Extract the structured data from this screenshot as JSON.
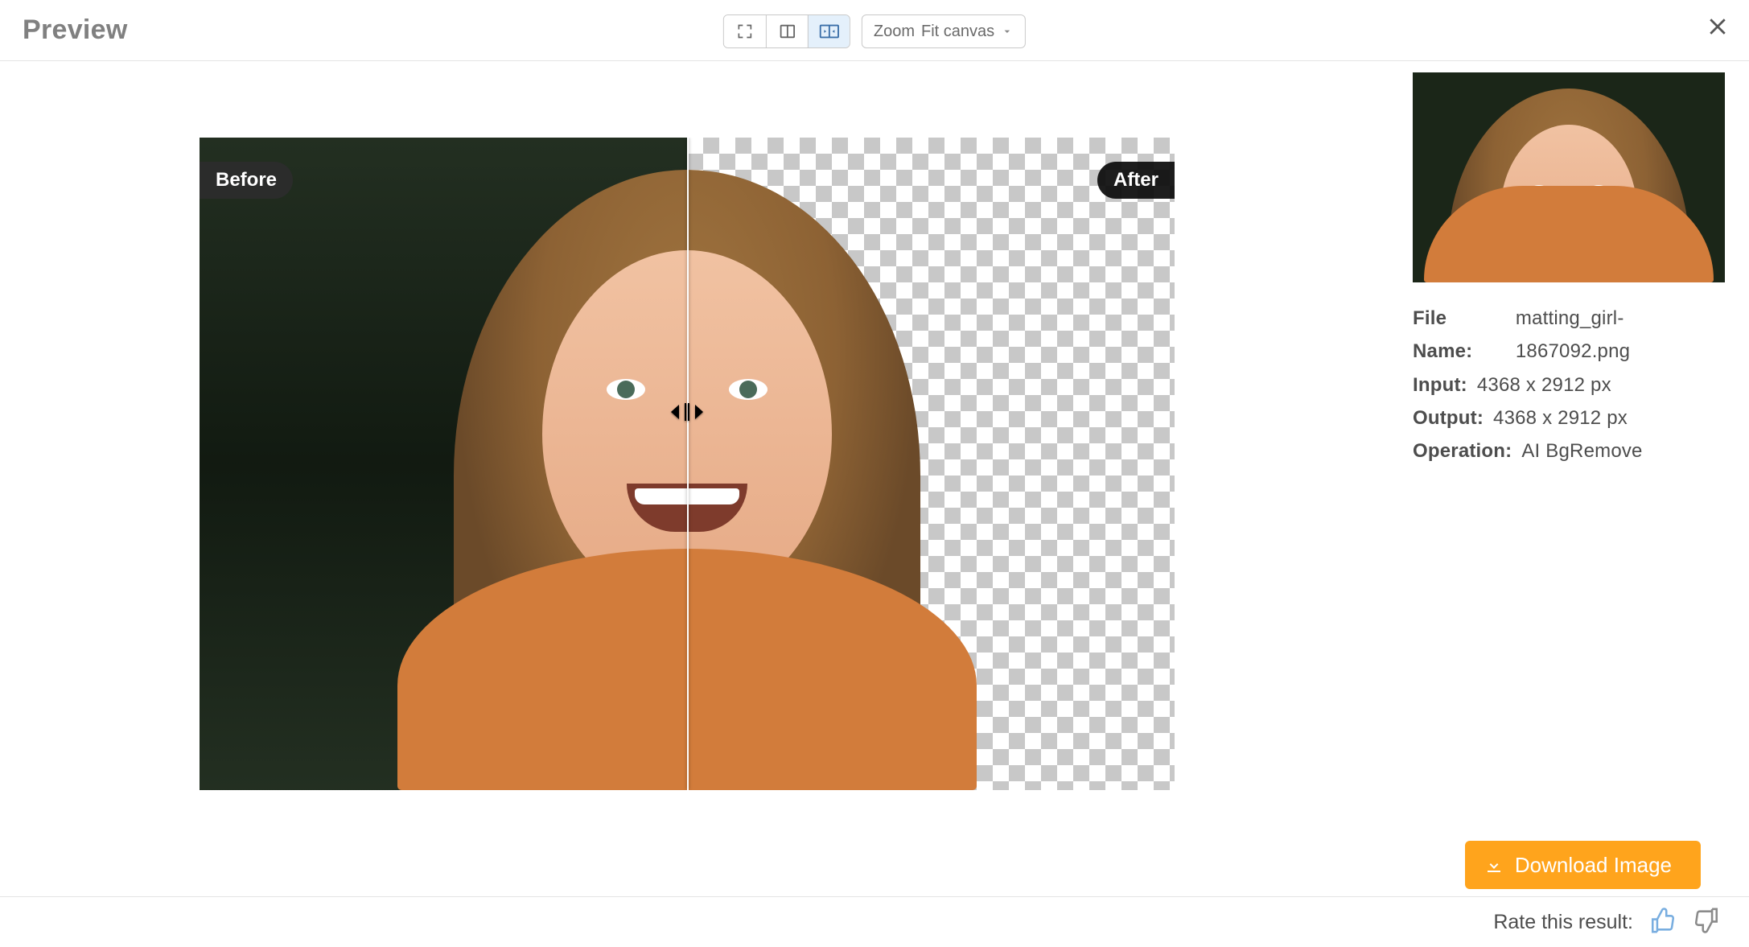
{
  "header": {
    "title": "Preview"
  },
  "controls": {
    "zoom_label": "Zoom",
    "zoom_value": "Fit canvas"
  },
  "canvas": {
    "before_label": "Before",
    "after_label": "After"
  },
  "meta": {
    "file_name_label": "File Name:",
    "file_name": "matting_girl-1867092.png",
    "input_label": "Input:",
    "input": "4368 x 2912 px",
    "output_label": "Output:",
    "output": "4368 x 2912 px",
    "operation_label": "Operation:",
    "operation": "AI BgRemove"
  },
  "actions": {
    "download": "Download Image"
  },
  "footer": {
    "rate_label": "Rate this result:"
  }
}
